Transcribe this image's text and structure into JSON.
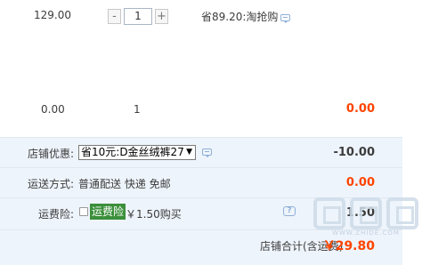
{
  "items": [
    {
      "price": "129.00",
      "quantity": "1",
      "stepper_minus": "-",
      "stepper_plus": "+",
      "promo": "省89.20:淘抢购",
      "total": ""
    },
    {
      "price": "0.00",
      "quantity": "1",
      "total": "0.00"
    }
  ],
  "shop": {
    "discount": {
      "label": "店铺优惠:",
      "selected": "省10元:D金丝绒裤27",
      "amount": "-10.00"
    },
    "shipping": {
      "label": "运送方式:",
      "value": "普通配送 快递 免邮",
      "amount": "0.00"
    },
    "insurance": {
      "label": "运费险:",
      "tag": "运费险",
      "price": "￥1.50购买",
      "help": "?",
      "amount": "1.50"
    },
    "grand_total": {
      "label": "店铺合计(含运费)",
      "amount": "￥29.80"
    }
  },
  "watermark_text": "WWW.ZHIDE.COM",
  "colors": {
    "accent_red": "#ff4400",
    "panel_bg": "#eef4fb",
    "tag_green": "#3b8f3b"
  }
}
